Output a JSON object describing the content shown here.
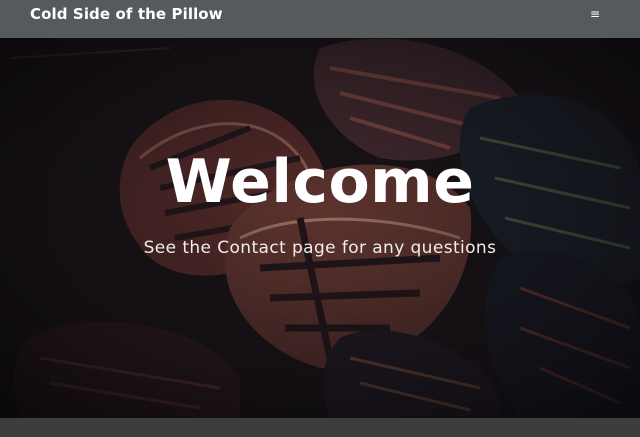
{
  "navbar": {
    "brand": "Cold Side of the Pillow",
    "menu_icon": "hamburger-menu-icon",
    "menu_glyph": "≡"
  },
  "hero": {
    "title": "Welcome",
    "subtitle": "See the Contact page for any questions",
    "background_image": "dark-croton-leaves-photo"
  },
  "colors": {
    "navbar_bg": "#575a5c",
    "text": "#ffffff",
    "leaf_red": "#b2574a",
    "leaf_dark": "#1f2636",
    "footer_bg": "#3d3d3d"
  }
}
